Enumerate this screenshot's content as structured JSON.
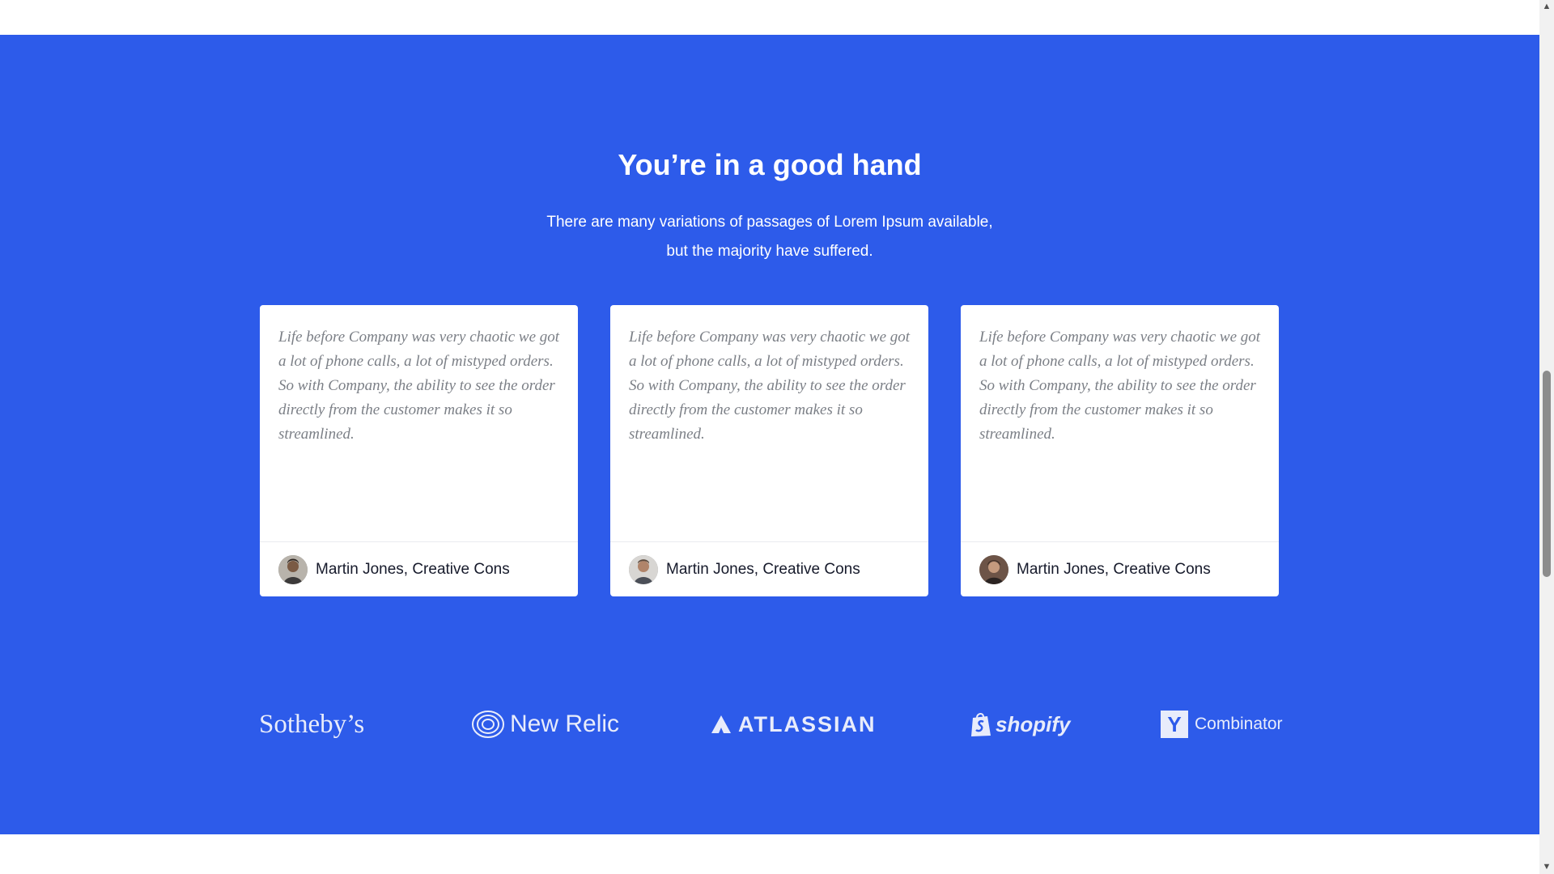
{
  "section": {
    "title": "You’re in a good hand",
    "subtitle_line1": "There are many variations of passages of Lorem Ipsum available,",
    "subtitle_line2": "but the majority have suffered."
  },
  "testimonials": [
    {
      "quote": "Life before Company was very chaotic we got a lot of phone calls, a lot of mistyped orders. So with Company, the ability to see the order directly from the customer makes it so streamlined.",
      "author": "Martin Jones, Creative Cons"
    },
    {
      "quote": "Life before Company was very chaotic we got a lot of phone calls, a lot of mistyped orders. So with Company, the ability to see the order directly from the customer makes it so streamlined.",
      "author": "Martin Jones, Creative Cons"
    },
    {
      "quote": "Life before Company was very chaotic we got a lot of phone calls, a lot of mistyped orders. So with Company, the ability to see the order directly from the customer makes it so streamlined.",
      "author": "Martin Jones, Creative Cons"
    }
  ],
  "logos": {
    "sothebys": "Sotheby’s",
    "newrelic": "New Relic",
    "atlassian": "ATLASSIAN",
    "shopify": "shopify",
    "yc_mark": "Y",
    "yc_text": "Combinator"
  },
  "colors": {
    "band_background": "#2d5bea",
    "card_background": "#ffffff",
    "quote_text": "#7b7f86",
    "logo": "#e8ecfb"
  },
  "icons": {
    "avatar": "person-avatar",
    "newrelic": "concentric-rings-icon",
    "atlassian": "triangle-mark-icon",
    "shopify": "shopping-bag-icon",
    "scroll_up": "triangle-up-icon",
    "scroll_down": "triangle-down-icon"
  }
}
